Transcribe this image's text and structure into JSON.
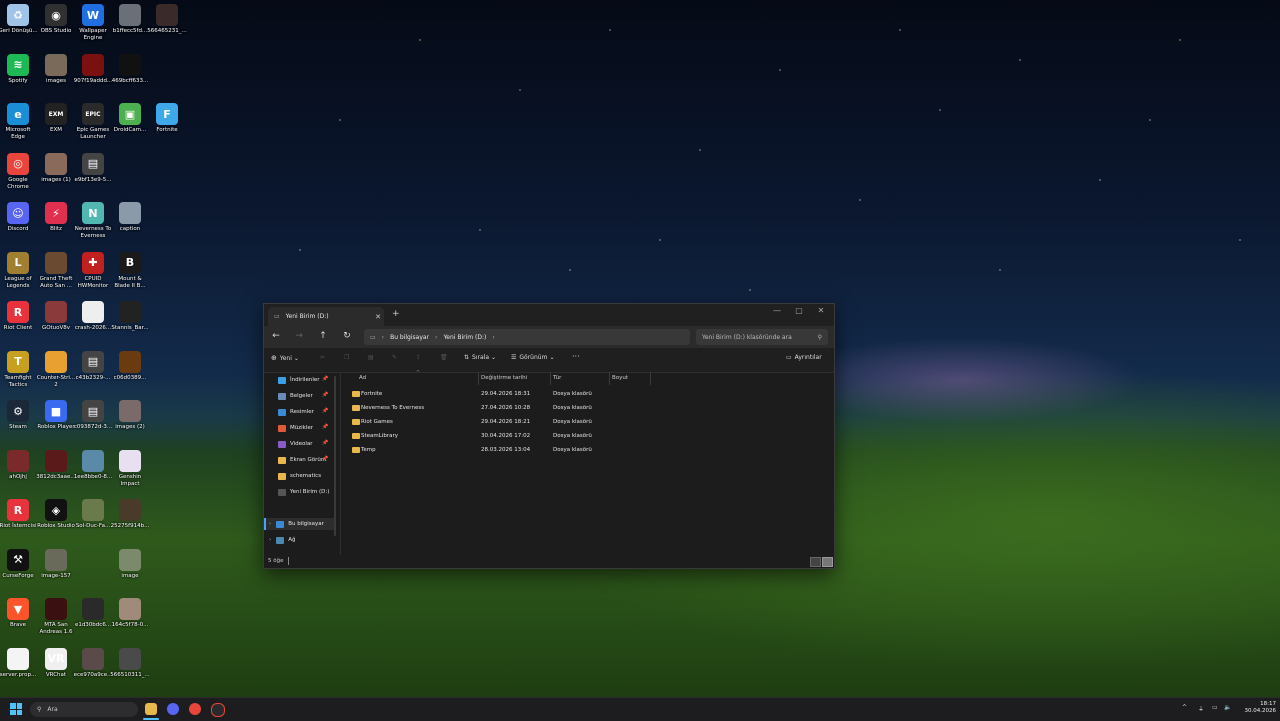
{
  "desktop": {
    "icons": [
      {
        "label": "Geri Dönüşü...",
        "icon": "recycle-bin-icon",
        "color": "#9fc4e8",
        "glyph": "♻"
      },
      {
        "label": "OBS Studio",
        "icon": "obs-icon",
        "color": "#303030",
        "glyph": "◉"
      },
      {
        "label": "Wallpaper Engine",
        "icon": "wallpaper-engine-icon",
        "color": "#1f6fe0",
        "glyph": "W"
      },
      {
        "label": "b1ffecc5fd...",
        "icon": "image-file-icon",
        "color": "#6a6f78",
        "glyph": ""
      },
      {
        "label": "566465231_...",
        "icon": "image-file-icon",
        "color": "#3a2a2a",
        "glyph": ""
      },
      {
        "label": "Spotify",
        "icon": "spotify-icon",
        "color": "#1db954",
        "glyph": "≋"
      },
      {
        "label": "images",
        "icon": "image-file-icon",
        "color": "#7a6a5a",
        "glyph": ""
      },
      {
        "label": "907f19addd...",
        "icon": "image-file-icon",
        "color": "#7a1010",
        "glyph": ""
      },
      {
        "label": "469bcff633...",
        "icon": "image-file-icon",
        "color": "#111111",
        "glyph": ""
      },
      {
        "label": "Microsoft Edge",
        "icon": "edge-icon",
        "color": "#1a8fd6",
        "glyph": "e"
      },
      {
        "label": "EXM",
        "icon": "exm-icon",
        "color": "#222222",
        "glyph": "EXM"
      },
      {
        "label": "Epic Games Launcher",
        "icon": "epic-games-icon",
        "color": "#2a2a2a",
        "glyph": "EPIC"
      },
      {
        "label": "DroidCam...",
        "icon": "droidcam-icon",
        "color": "#4caf50",
        "glyph": "▣"
      },
      {
        "label": "Fortnite",
        "icon": "fortnite-icon",
        "color": "#3fa8e8",
        "glyph": "F"
      },
      {
        "label": "Google Chrome",
        "icon": "chrome-icon",
        "color": "#e8453c",
        "glyph": "◎"
      },
      {
        "label": "images (1)",
        "icon": "image-file-icon",
        "color": "#8a6a5a",
        "glyph": ""
      },
      {
        "label": "e9bf13e9-5...",
        "icon": "file-icon",
        "color": "#444444",
        "glyph": "▤"
      },
      {
        "label": "Discord",
        "icon": "discord-icon",
        "color": "#5865f2",
        "glyph": "☺"
      },
      {
        "label": "Blitz",
        "icon": "blitz-icon",
        "color": "#e03050",
        "glyph": "⚡"
      },
      {
        "label": "Neverness To Everness",
        "icon": "nte-icon",
        "color": "#50b8b0",
        "glyph": "N"
      },
      {
        "label": "caption",
        "icon": "image-file-icon",
        "color": "#8a9aa8",
        "glyph": ""
      },
      {
        "label": "League of Legends",
        "icon": "lol-icon",
        "color": "#a08030",
        "glyph": "L"
      },
      {
        "label": "Grand Theft Auto San ...",
        "icon": "gta-icon",
        "color": "#6a4a30",
        "glyph": ""
      },
      {
        "label": "CPUID HWMonitor",
        "icon": "hwmonitor-icon",
        "color": "#c02020",
        "glyph": "✚"
      },
      {
        "label": "Mount & Blade II B...",
        "icon": "bannerlord-icon",
        "color": "#1a1a1a",
        "glyph": "B"
      },
      {
        "label": "Riot Client",
        "icon": "riot-client-icon",
        "color": "#e8323c",
        "glyph": "R"
      },
      {
        "label": "GOtuoV8v",
        "icon": "image-file-icon",
        "color": "#8a3a3a",
        "glyph": ""
      },
      {
        "label": "crash-2026...",
        "icon": "file-icon",
        "color": "#eeeeee",
        "glyph": ""
      },
      {
        "label": "Stannis_Bar...",
        "icon": "image-file-icon",
        "color": "#222222",
        "glyph": ""
      },
      {
        "label": "Teamfight Tactics",
        "icon": "tft-icon",
        "color": "#c8a020",
        "glyph": "T"
      },
      {
        "label": "Counter-Stri... 2",
        "icon": "cs2-icon",
        "color": "#e8a030",
        "glyph": ""
      },
      {
        "label": "c43b2329-...",
        "icon": "file-icon",
        "color": "#444444",
        "glyph": "▤"
      },
      {
        "label": "c06d0389...",
        "icon": "image-file-icon",
        "color": "#6a3a10",
        "glyph": ""
      },
      {
        "label": "Steam",
        "icon": "steam-icon",
        "color": "#1b2838",
        "glyph": "⚙"
      },
      {
        "label": "Roblox Player",
        "icon": "roblox-player-icon",
        "color": "#3a6af0",
        "glyph": "■"
      },
      {
        "label": "c093872d-3...",
        "icon": "file-icon",
        "color": "#444444",
        "glyph": "▤"
      },
      {
        "label": "images (2)",
        "icon": "image-file-icon",
        "color": "#7a6a6a",
        "glyph": ""
      },
      {
        "label": "ahOjhj",
        "icon": "image-file-icon",
        "color": "#7a2a2a",
        "glyph": ""
      },
      {
        "label": "3812dc3aae...",
        "icon": "image-file-icon",
        "color": "#5a1a1a",
        "glyph": ""
      },
      {
        "label": "1ee8bbe0-8...",
        "icon": "file-icon",
        "color": "#5a8aa8",
        "glyph": ""
      },
      {
        "label": "Genshin Impact",
        "icon": "genshin-icon",
        "color": "#e8e0f0",
        "glyph": ""
      },
      {
        "label": "Riot İstemcisi",
        "icon": "riot-client-icon",
        "color": "#e8323c",
        "glyph": "R"
      },
      {
        "label": "Roblox Studio",
        "icon": "roblox-studio-icon",
        "color": "#111111",
        "glyph": "◈"
      },
      {
        "label": "Sol-Duc-Fa...",
        "icon": "image-file-icon",
        "color": "#6a7a4a",
        "glyph": ""
      },
      {
        "label": "25275f914b...",
        "icon": "image-file-icon",
        "color": "#4a3a2a",
        "glyph": ""
      },
      {
        "label": "CurseForge",
        "icon": "curseforge-icon",
        "color": "#111111",
        "glyph": "⚒"
      },
      {
        "label": "image-157",
        "icon": "image-file-icon",
        "color": "#6a6a5a",
        "glyph": ""
      },
      {
        "label": "image",
        "icon": "image-file-icon",
        "color": "#7a8a6a",
        "glyph": ""
      },
      {
        "label": "Brave",
        "icon": "brave-icon",
        "color": "#fb542b",
        "glyph": "▼"
      },
      {
        "label": "MTA San Andreas 1.6",
        "icon": "mta-icon",
        "color": "#3a1010",
        "glyph": ""
      },
      {
        "label": "e1d30bdc6...",
        "icon": "image-file-icon",
        "color": "#2a2a2a",
        "glyph": ""
      },
      {
        "label": "164c5f78-0...",
        "icon": "image-file-icon",
        "color": "#a08a7a",
        "glyph": ""
      },
      {
        "label": "server.prop...",
        "icon": "file-icon",
        "color": "#f4f4f4",
        "glyph": ""
      },
      {
        "label": "VRChat",
        "icon": "vrchat-icon",
        "color": "#f0f0f0",
        "glyph": "VR"
      },
      {
        "label": "ece970a9ce...",
        "icon": "image-file-icon",
        "color": "#5a4a4a",
        "glyph": ""
      },
      {
        "label": "566510311_...",
        "icon": "image-file-icon",
        "color": "#4a4a4a",
        "glyph": ""
      }
    ]
  },
  "explorer": {
    "tab_title": "Yeni Birim (D:)",
    "breadcrumb": [
      "Bu bilgisayar",
      "Yeni Birim (D:)"
    ],
    "search_placeholder": "Yeni Birim (D:) klasöründe ara",
    "toolbar": {
      "new_label": "Yeni",
      "sort_label": "Sırala",
      "view_label": "Görünüm",
      "more_label": "···",
      "details_label": "Ayrıntılar"
    },
    "sidebar": {
      "quick_access": [
        {
          "label": "İndirilenler",
          "color": "#3aa0e8",
          "pinned": true
        },
        {
          "label": "Belgeler",
          "color": "#6a8ab8",
          "pinned": true
        },
        {
          "label": "Resimler",
          "color": "#3a8ad8",
          "pinned": true
        },
        {
          "label": "Müzikler",
          "color": "#e05a3a",
          "pinned": true
        },
        {
          "label": "Videolar",
          "color": "#8a5ac8",
          "pinned": true
        },
        {
          "label": "Ekran Görünt",
          "color": "#e8b84a",
          "pinned": true
        },
        {
          "label": "schematics",
          "color": "#e8b84a",
          "pinned": false
        },
        {
          "label": "Yeni Birim (D:)",
          "color": "#555555",
          "pinned": false
        }
      ],
      "this_pc": "Bu bilgisayar",
      "network": "Ağ"
    },
    "columns": [
      "Ad",
      "Değiştirme tarihi",
      "Tür",
      "Boyut"
    ],
    "rows": [
      {
        "name": "Fortnite",
        "date": "29.04.2026 18:31",
        "type": "Dosya klasörü",
        "size": ""
      },
      {
        "name": "Neverness To Everness",
        "date": "27.04.2026 10:28",
        "type": "Dosya klasörü",
        "size": ""
      },
      {
        "name": "Riot Games",
        "date": "29.04.2026 18:21",
        "type": "Dosya klasörü",
        "size": ""
      },
      {
        "name": "SteamLibrary",
        "date": "30.04.2026 17:02",
        "type": "Dosya klasörü",
        "size": ""
      },
      {
        "name": "Temp",
        "date": "28.03.2026 13:04",
        "type": "Dosya klasörü",
        "size": ""
      }
    ],
    "status": "5 öğe"
  },
  "taskbar": {
    "search_label": "Ara",
    "time": "18:17",
    "date": "30.04.2026"
  }
}
